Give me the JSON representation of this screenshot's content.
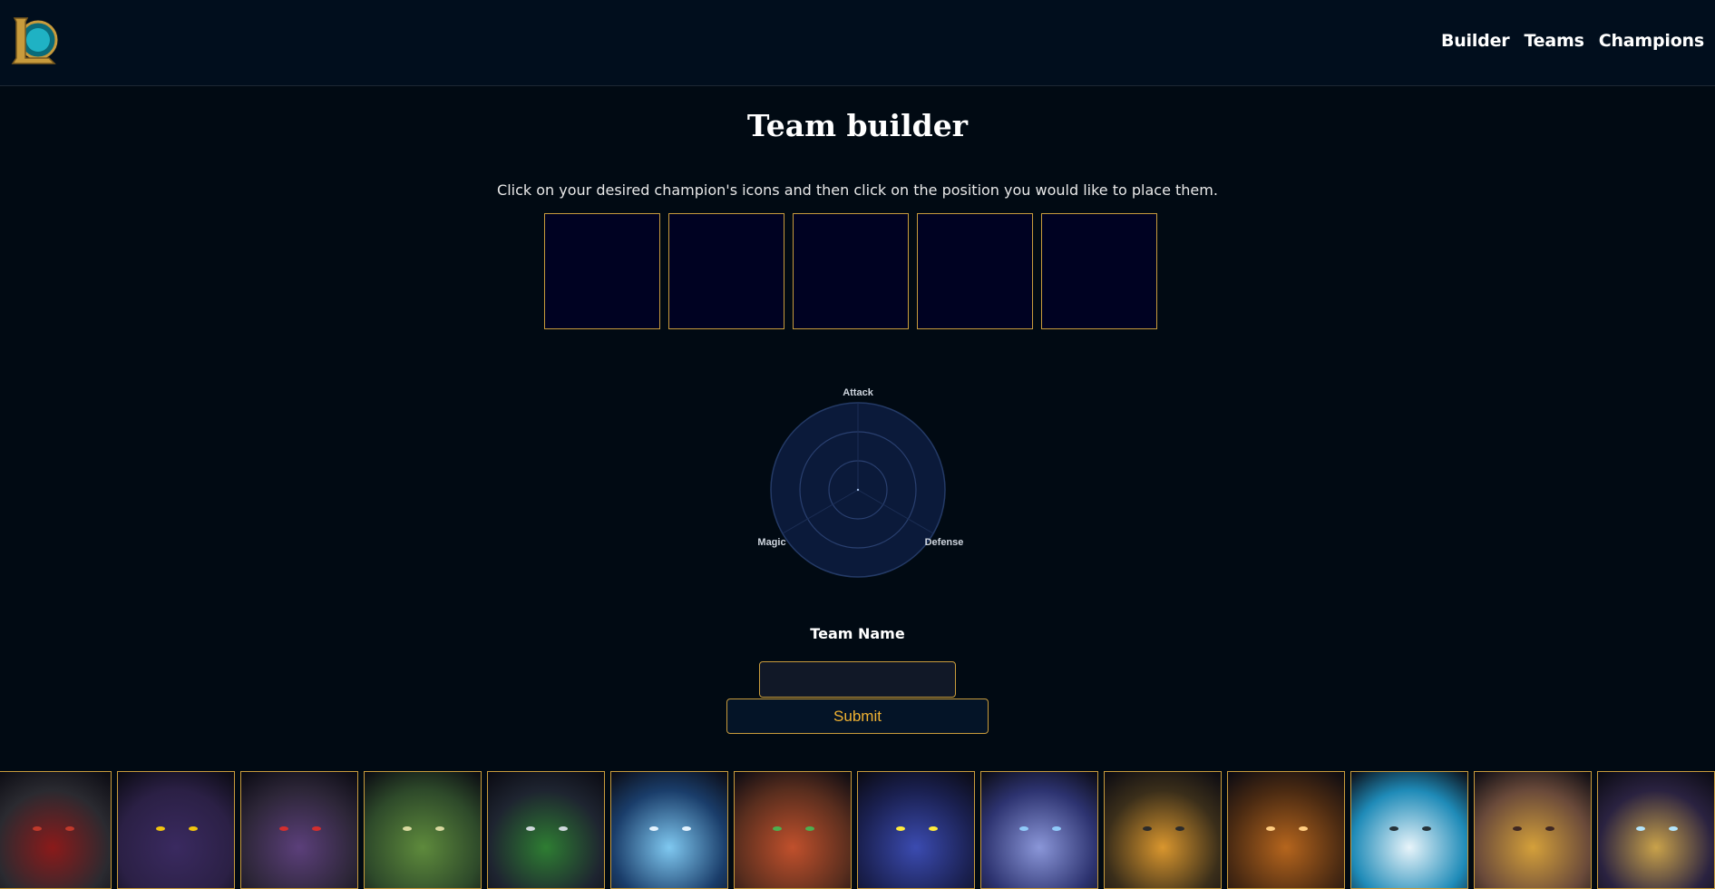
{
  "header": {
    "logo_letter": "L",
    "nav": [
      "Builder",
      "Teams",
      "Champions"
    ]
  },
  "main": {
    "title": "Team builder",
    "instructions": "Click on your desired champion's icons and then click on the position you would like to place them.",
    "slot_count": 5
  },
  "radar": {
    "labels": {
      "top": "Attack",
      "left": "Magic",
      "right": "Defense"
    },
    "values": {
      "attack": 0,
      "magic": 0,
      "defense": 0
    }
  },
  "form": {
    "team_name_label": "Team Name",
    "team_name_value": "",
    "submit_label": "Submit"
  },
  "champions": [
    {
      "icon": "champion-dark-warrior-icon",
      "bg": "#2a2a30",
      "accent": "#8b1a1a",
      "eye": "#c0392b"
    },
    {
      "icon": "champion-fox-mage-icon",
      "bg": "#2b2045",
      "accent": "#3a2a60",
      "eye": "#f1c40f"
    },
    {
      "icon": "champion-yordle-beast-icon",
      "bg": "#2d2638",
      "accent": "#5b3f7a",
      "eye": "#d32f2f"
    },
    {
      "icon": "champion-mummy-icon",
      "bg": "#2e4a2a",
      "accent": "#5e8a3c",
      "eye": "#d9d9a0"
    },
    {
      "icon": "champion-ninja-icon",
      "bg": "#1e2430",
      "accent": "#2e7d32",
      "eye": "#cfd8dc"
    },
    {
      "icon": "champion-ice-drake-icon",
      "bg": "#1a3d6a",
      "accent": "#7fc8f0",
      "eye": "#e3f2fd"
    },
    {
      "icon": "champion-red-haired-girl-icon",
      "bg": "#5a2e1e",
      "accent": "#c0502c",
      "eye": "#4caf50"
    },
    {
      "icon": "champion-cosmic-bear-icon",
      "bg": "#1a2050",
      "accent": "#3b4bb0",
      "eye": "#ffeb3b"
    },
    {
      "icon": "champion-archer-icon",
      "bg": "#2d3370",
      "accent": "#8a96d8",
      "eye": "#90caf9"
    },
    {
      "icon": "champion-golden-robot-icon",
      "bg": "#3a2e1a",
      "accent": "#d9962e",
      "eye": "#2b2b2b"
    },
    {
      "icon": "champion-minotaur-icon",
      "bg": "#4a2a12",
      "accent": "#b5651d",
      "eye": "#ffcc80"
    },
    {
      "icon": "champion-walrus-icon",
      "bg": "#1f8bb8",
      "accent": "#e8f4fa",
      "eye": "#263238"
    },
    {
      "icon": "champion-golden-knight-icon",
      "bg": "#6a4a3a",
      "accent": "#d4a03a",
      "eye": "#3e2723"
    },
    {
      "icon": "champion-steam-golem-icon",
      "bg": "#2a2240",
      "accent": "#c9a24a",
      "eye": "#b3e5fc"
    }
  ],
  "colors": {
    "accent_gold": "#c89b3c",
    "submit_text": "#f0b232",
    "background": "#010a13",
    "header_bg": "#010e1d",
    "slot_bg": "#000222",
    "radar_fill": "#0b1a3a"
  }
}
